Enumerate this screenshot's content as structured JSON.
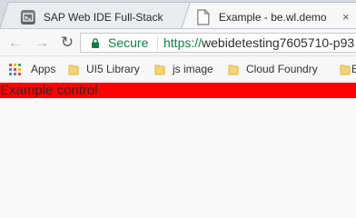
{
  "tabs": [
    {
      "title": "SAP Web IDE Full-Stack",
      "icon": "sap-web-ide-icon"
    },
    {
      "title": "Example - be.wl.demo",
      "icon": "page-icon",
      "close_label": "×",
      "close_icon": "close-icon"
    }
  ],
  "toolbar": {
    "back_label": "←",
    "back_icon": "arrow-left-icon",
    "forward_label": "→",
    "forward_icon": "arrow-right-icon",
    "reload_label": "↻",
    "reload_icon": "reload-icon"
  },
  "address": {
    "security_text": "Secure",
    "security_icon": "lock-icon",
    "url_scheme": "https://",
    "url_rest": "webidetesting7605710-p93"
  },
  "bookmarks": [
    {
      "label": "Apps",
      "icon": "apps-grid-icon"
    },
    {
      "label": "UI5 Library",
      "icon": "folder-icon"
    },
    {
      "label": "js image",
      "icon": "folder-icon"
    },
    {
      "label": "Cloud Foundry",
      "icon": "folder-icon"
    },
    {
      "label": "B",
      "icon": "folder-icon"
    }
  ],
  "page": {
    "example_control_text": "Example control",
    "example_control_color": "#ff0000"
  },
  "colors": {
    "secure_green": "#0b8043",
    "tabstrip": "#d6dbe1",
    "active_tab": "#f7f7f7",
    "folder_yellow": "#f5d66d"
  }
}
